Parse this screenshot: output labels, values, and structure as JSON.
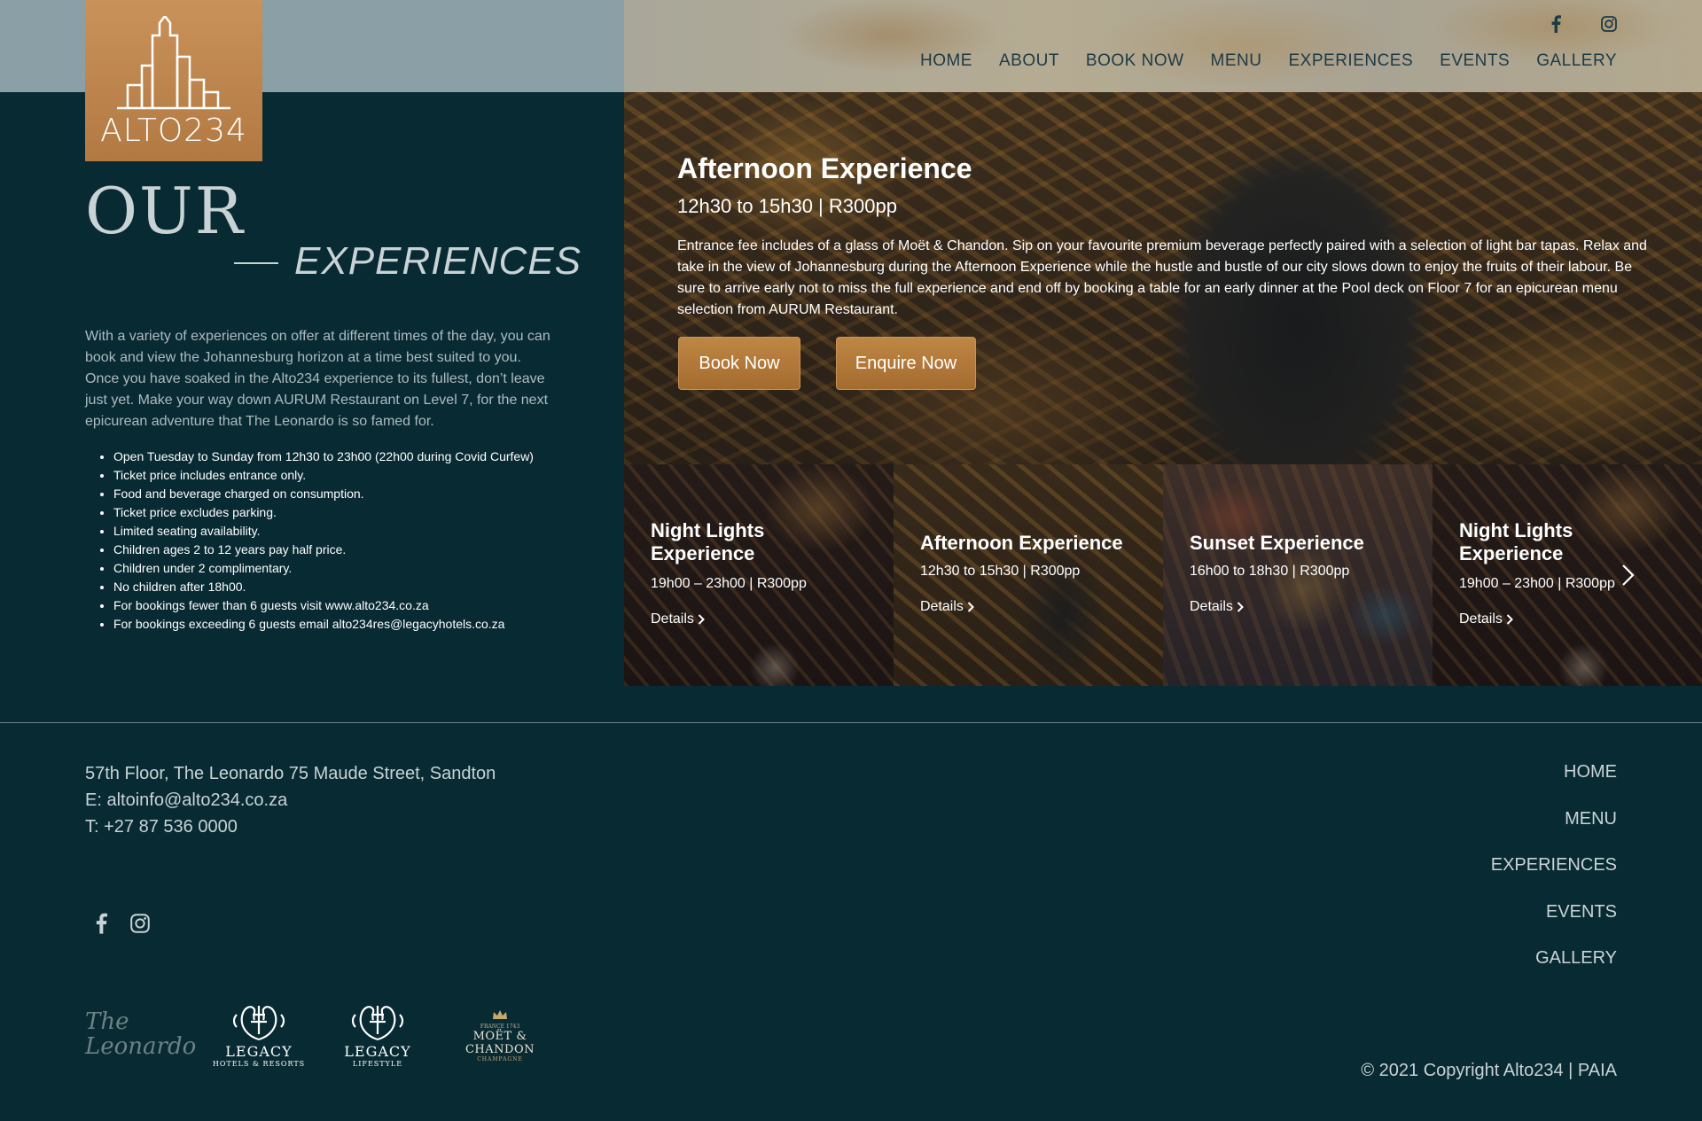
{
  "brand": {
    "logo_text": "ALTO234"
  },
  "header": {
    "nav": [
      "HOME",
      "ABOUT",
      "BOOK NOW",
      "MENU",
      "EXPERIENCES",
      "EVENTS",
      "GALLERY"
    ],
    "social": [
      "facebook-icon",
      "instagram-icon"
    ]
  },
  "intro": {
    "heading_top": "OUR",
    "heading_bottom": "EXPERIENCES",
    "text": "With a variety of experiences on offer at different times of the day, you can book and view the Johannesburg horizon at a time best suited to you. Once you have soaked in the Alto234 experience to its fullest, don’t leave just yet. Make your way down AURUM Restaurant on Level 7, for the next epicurean adventure that The Leonardo is so famed for.",
    "rules": [
      "Open Tuesday to Sunday from 12h30 to 23h00 (22h00 during Covid Curfew)",
      "Ticket price includes entrance only.",
      "Food and beverage charged on consumption.",
      "Ticket price excludes parking.",
      "Limited seating availability.",
      "Children ages 2 to 12 years pay half price.",
      "Children under 2 complimentary.",
      "No children after 18h00.",
      "For bookings fewer than 6 guests visit www.alto234.co.za",
      "For bookings exceeding 6 guests email alto234res@legacyhotels.co.za"
    ]
  },
  "hero": {
    "title": "Afternoon Experience",
    "subtitle": "12h30 to 15h30 | R300pp",
    "description": "Entrance fee includes of a glass of Moët & Chandon. Sip on your favourite premium beverage perfectly paired with a selection of light bar tapas. Relax and take in the view of Johannesburg during the Afternoon Experience while the hustle and bustle of our city slows down to enjoy the fruits of their labour. Be sure to arrive early not to miss the full experience and end off by booking a table for an early dinner at the Pool deck on Floor 7 for an epicurean menu selection from AURUM Restaurant.",
    "book_label": "Book Now",
    "enquire_label": "Enquire Now"
  },
  "carousel": {
    "cards": [
      {
        "title": "Night Lights Experience",
        "meta": "19h00 – 23h00 | R300pp",
        "details": "Details"
      },
      {
        "title": "Afternoon Experience",
        "meta": "12h30 to 15h30 | R300pp",
        "details": "Details"
      },
      {
        "title": "Sunset Experience",
        "meta": "16h00 to 18h30 | R300pp",
        "details": "Details"
      },
      {
        "title": "Night Lights Experience",
        "meta": "19h00 – 23h00 | R300pp",
        "details": "Details"
      }
    ],
    "next_icon": "chevron-right-icon"
  },
  "footer": {
    "address": "57th Floor, The Leonardo 75 Maude Street, Sandton",
    "email": "E: altoinfo@alto234.co.za",
    "phone": "T: +27 87 536 0000",
    "nav": [
      "HOME",
      "MENU",
      "EXPERIENCES",
      "EVENTS",
      "GALLERY"
    ],
    "copyright": "© 2021 Copyright Alto234 | PAIA",
    "partners": {
      "leonardo": "The Leonardo",
      "legacy_hotels": {
        "name": "LEGACY",
        "tag": "HOTELS & RESORTS"
      },
      "legacy_lifestyle": {
        "name": "LEGACY",
        "tag": "LIFESTYLE"
      },
      "moet": {
        "top": "FRANCE 1743",
        "name": "MOËT & CHANDON",
        "tag": "CHAMPAGNE"
      }
    }
  },
  "colors": {
    "background": "#082a33",
    "accent": "#b27a42",
    "topband": "#8aa0a6"
  }
}
